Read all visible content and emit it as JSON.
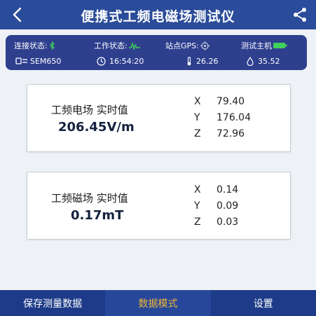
{
  "header": {
    "title": "便携式工频电磁场测试仪"
  },
  "status": {
    "connection_label": "连接状态:",
    "work_label": "工作状态:",
    "gps_label": "站点GPS:",
    "host_label": "测试主机",
    "device_name": "SEM650",
    "time": "16:54:20",
    "temperature": "26.26",
    "humidity": "35.52"
  },
  "electric_field": {
    "title": "工频电场 实时值",
    "value": "206.45V/m",
    "axes": [
      {
        "label": "X",
        "value": "79.40"
      },
      {
        "label": "Y",
        "value": "176.04"
      },
      {
        "label": "Z",
        "value": "72.96"
      }
    ]
  },
  "magnetic_field": {
    "title": "工频磁场 实时值",
    "value": "0.17mT",
    "axes": [
      {
        "label": "X",
        "value": "0.14"
      },
      {
        "label": "Y",
        "value": "0.09"
      },
      {
        "label": "Z",
        "value": "0.03"
      }
    ]
  },
  "tabs": [
    {
      "label": "保存测量数据",
      "active": false
    },
    {
      "label": "数据模式",
      "active": true
    },
    {
      "label": "设置",
      "active": false
    }
  ],
  "icons": {
    "back": "back-arrow-icon",
    "share": "share-icon",
    "bluetooth": "bluetooth-icon",
    "signal": "signal-wave-icon",
    "gps": "gps-target-icon",
    "battery": "battery-icon",
    "device": "device-icon",
    "clock": "clock-icon",
    "thermometer": "thermometer-icon",
    "droplet": "humidity-drop-icon"
  },
  "colors": {
    "header": "#2b4c9a",
    "panel": "#2e3f8e",
    "tab_bar": "#1d3b88",
    "active_tab_text": "#f2b437",
    "indicator_green": "#3fd15a"
  }
}
